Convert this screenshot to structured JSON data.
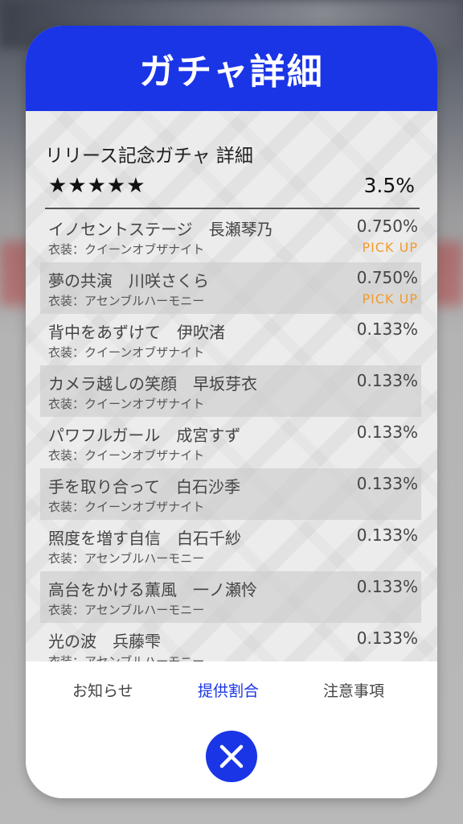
{
  "modal": {
    "title": "ガチャ詳細"
  },
  "detail": {
    "section_title": "リリース記念ガチャ 詳細",
    "rarity_stars": "★★★★★",
    "rarity_rate": "3.5%",
    "items": [
      {
        "name": "イノセントステージ　長瀬琴乃",
        "costume": "衣装：クイーンオブザナイト",
        "rate": "0.750%",
        "pickup": "PICK UP"
      },
      {
        "name": "夢の共演　川咲さくら",
        "costume": "衣装：アセンブルハーモニー",
        "rate": "0.750%",
        "pickup": "PICK UP"
      },
      {
        "name": "背中をあずけて　伊吹渚",
        "costume": "衣装：クイーンオブザナイト",
        "rate": "0.133%",
        "pickup": ""
      },
      {
        "name": "カメラ越しの笑顔　早坂芽衣",
        "costume": "衣装：クイーンオブザナイト",
        "rate": "0.133%",
        "pickup": ""
      },
      {
        "name": "パワフルガール　成宮すず",
        "costume": "衣装：クイーンオブザナイト",
        "rate": "0.133%",
        "pickup": ""
      },
      {
        "name": "手を取り合って　白石沙季",
        "costume": "衣装：クイーンオブザナイト",
        "rate": "0.133%",
        "pickup": ""
      },
      {
        "name": "照度を増す自信　白石千紗",
        "costume": "衣装：アセンブルハーモニー",
        "rate": "0.133%",
        "pickup": ""
      },
      {
        "name": "高台をかける薫風　一ノ瀬怜",
        "costume": "衣装：アセンブルハーモニー",
        "rate": "0.133%",
        "pickup": ""
      },
      {
        "name": "光の波　兵藤雫",
        "costume": "衣装：アセンブルハーモニー",
        "rate": "0.133%",
        "pickup": ""
      }
    ]
  },
  "tabs": {
    "notice": "お知らせ",
    "rates": "提供割合",
    "caution": "注意事項",
    "active": "rates"
  },
  "icons": {
    "close": "close-icon"
  },
  "colors": {
    "accent": "#1a35e6",
    "pickup": "#f39a2b"
  }
}
